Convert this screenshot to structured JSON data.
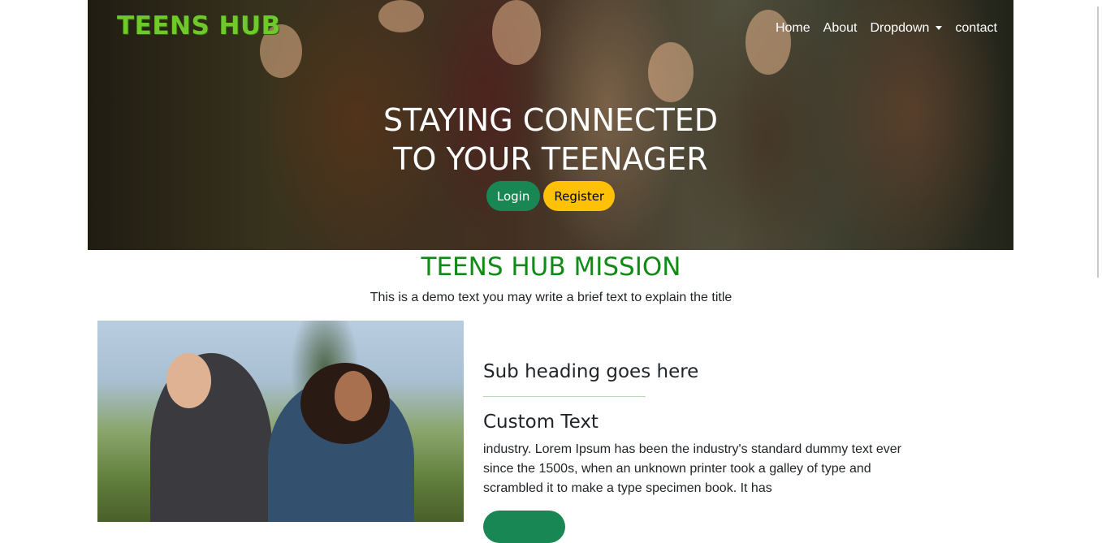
{
  "header": {
    "brand": "TEENS HUB",
    "nav": [
      "Home",
      "About",
      "Dropdown",
      "contact"
    ]
  },
  "hero": {
    "title_line1": "STAYING CONNECTED",
    "title_line2": "TO YOUR TEENAGER",
    "login_label": "Login",
    "register_label": "Register"
  },
  "mission": {
    "title": "TEENS HUB MISSION",
    "text": "This is a demo text you may write a brief text to explain the title"
  },
  "content": {
    "subheading": "Sub heading goes here",
    "title": "Custom Text",
    "body": "industry. Lorem Ipsum has been the industry's standard dummy text ever since the 1500s, when an unknown printer took a galley of type and scrambled it to make a type specimen book. It has"
  },
  "colors": {
    "brand_green": "#6fc92a",
    "mission_green": "#118a16",
    "login_green": "#198754",
    "register_yellow": "#ffc107"
  }
}
